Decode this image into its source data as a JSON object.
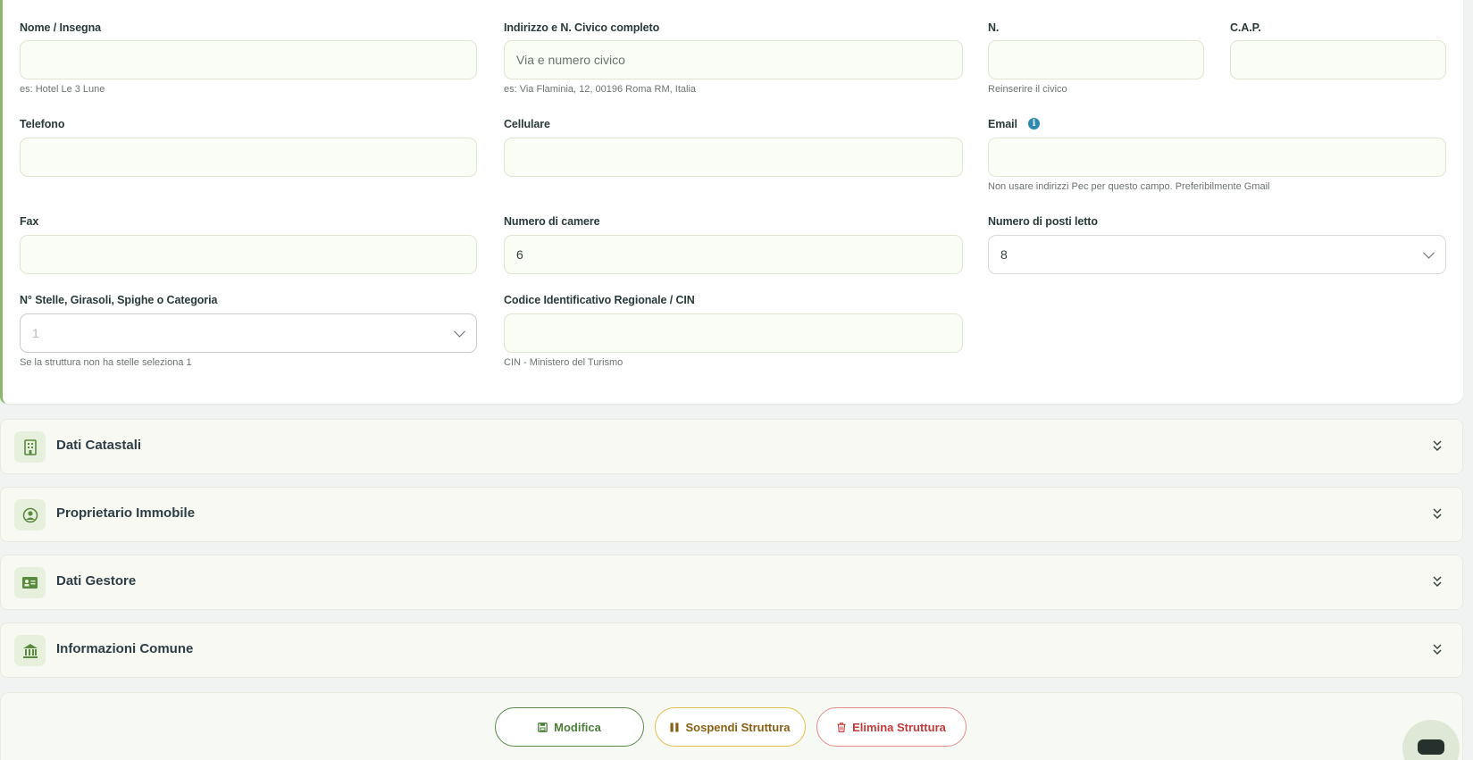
{
  "form": {
    "nome": {
      "label": "Nome / Insegna",
      "value": "",
      "help": "es: Hotel Le 3 Lune"
    },
    "indirizzo": {
      "label": "Indirizzo e N. Civico completo",
      "placeholder": "Via e numero civico",
      "help": "es: Via Flaminia, 12, 00196 Roma RM, Italia"
    },
    "civico": {
      "label": "N.",
      "value": "",
      "help": "Reinserire il civico"
    },
    "cap": {
      "label": "C.A.P.",
      "value": ""
    },
    "telefono": {
      "label": "Telefono",
      "value": ""
    },
    "cellulare": {
      "label": "Cellulare",
      "value": ""
    },
    "email": {
      "label": "Email",
      "value": "",
      "help": "Non usare indirizzi Pec per questo campo. Preferibilmente Gmail",
      "info_icon": "info-icon"
    },
    "fax": {
      "label": "Fax",
      "value": ""
    },
    "camere": {
      "label": "Numero di camere",
      "value": "6"
    },
    "posti_letto": {
      "label": "Numero di posti letto",
      "value": "8"
    },
    "stelle": {
      "label": "N° Stelle, Girasoli, Spighe o Categoria",
      "value": "1",
      "help": "Se la struttura non ha stelle seleziona 1"
    },
    "cin": {
      "label": "Codice Identificativo Regionale / CIN",
      "value": "",
      "help": "CIN - Ministero del Turismo"
    }
  },
  "sections": [
    {
      "title": "Dati Catastali",
      "icon": "building-icon"
    },
    {
      "title": "Proprietario Immobile",
      "icon": "user-circle-icon"
    },
    {
      "title": "Dati Gestore",
      "icon": "id-card-icon"
    },
    {
      "title": "Informazioni Comune",
      "icon": "bank-icon"
    }
  ],
  "actions": {
    "edit": {
      "label": "Modifica",
      "icon": "save-icon"
    },
    "suspend": {
      "label": "Sospendi Struttura",
      "icon": "pause-icon"
    },
    "delete": {
      "label": "Elimina Struttura",
      "icon": "trash-icon"
    }
  },
  "colors": {
    "accent_green": "#4b7f3a",
    "warning_gold": "#e0bf4a",
    "danger_red": "#c63a3a",
    "info_blue": "#2c8ab0"
  }
}
